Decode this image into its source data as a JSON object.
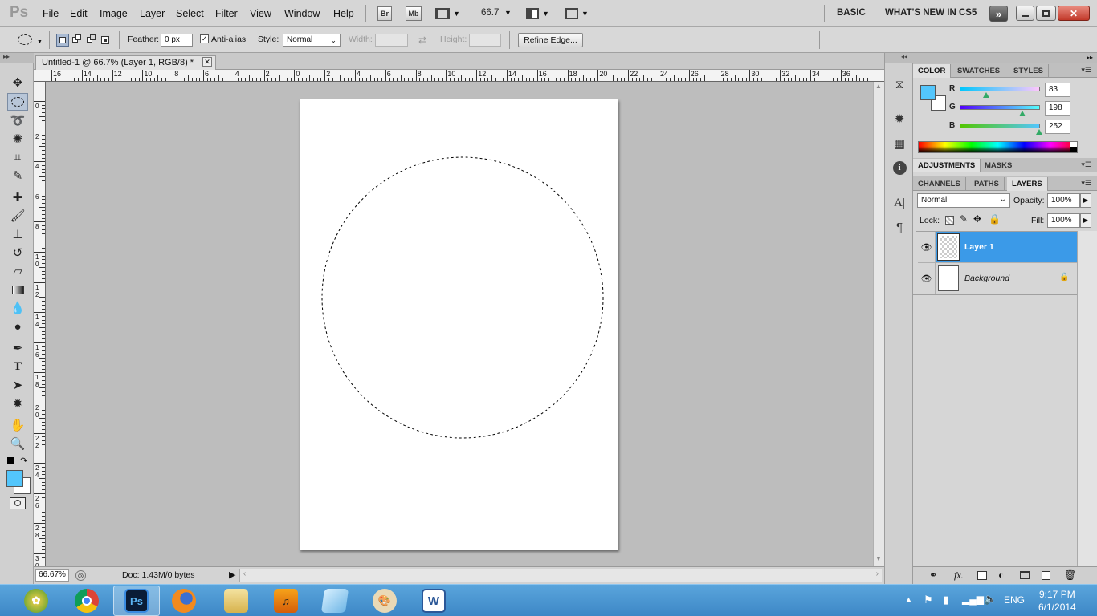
{
  "app": {
    "logo": "Ps"
  },
  "menu": [
    "File",
    "Edit",
    "Image",
    "Layer",
    "Select",
    "Filter",
    "View",
    "Window",
    "Help"
  ],
  "appbar": {
    "bridge": "Br",
    "minibridge": "Mb",
    "zoom": "66.7"
  },
  "workspace": {
    "basic": "BASIC",
    "whats_new": "WHAT'S NEW IN CS5"
  },
  "options": {
    "feather_label": "Feather:",
    "feather_value": "0 px",
    "antialias_label": "Anti-alias",
    "antialias_checked": true,
    "style_label": "Style:",
    "style_value": "Normal",
    "width_label": "Width:",
    "height_label": "Height:",
    "refine_edge": "Refine Edge..."
  },
  "document": {
    "tab_title": "Untitled-1 @ 66.7% (Layer 1, RGB/8) *"
  },
  "ruler_h": [
    "16",
    "14",
    "12",
    "10",
    "8",
    "6",
    "4",
    "2",
    "0",
    "2",
    "4",
    "6",
    "8",
    "10",
    "12",
    "14",
    "16",
    "18",
    "20",
    "22",
    "24",
    "26",
    "28",
    "30",
    "32",
    "34",
    "36"
  ],
  "ruler_v": [
    "0",
    "2",
    "4",
    "6",
    "8",
    "1\n0",
    "1\n2",
    "1\n4",
    "1\n6",
    "1\n8",
    "2\n0",
    "2\n2",
    "2\n4",
    "2\n6",
    "2\n8",
    "3\n0"
  ],
  "status": {
    "zoom": "66.67%",
    "doc": "Doc: 1.43M/0 bytes"
  },
  "color_panel": {
    "tabs": [
      "COLOR",
      "SWATCHES",
      "STYLES"
    ],
    "r_label": "R",
    "g_label": "G",
    "b_label": "B",
    "r": 83,
    "g": 198,
    "b": 252,
    "foreground": "#53c6fc",
    "background": "#ffffff"
  },
  "adjust_panel": {
    "tabs": [
      "ADJUSTMENTS",
      "MASKS"
    ]
  },
  "layers_panel": {
    "tabs": [
      "CHANNELS",
      "PATHS",
      "LAYERS"
    ],
    "blend_mode": "Normal",
    "opacity_label": "Opacity:",
    "opacity": "100%",
    "lock_label": "Lock:",
    "fill_label": "Fill:",
    "fill": "100%",
    "layers": [
      {
        "name": "Layer 1",
        "selected": true
      },
      {
        "name": "Background",
        "locked": true
      }
    ]
  },
  "taskbar": {
    "apps": [
      "Windows Live",
      "Chrome",
      "Photoshop",
      "Firefox",
      "File Explorer",
      "Music",
      "Notes",
      "Paint",
      "Word"
    ],
    "tray": {
      "lang": "ENG",
      "time": "9:17 PM",
      "date": "6/1/2014"
    }
  },
  "colors": {
    "accent": "#3b9ae8",
    "selection_blue": "#38a0f0"
  }
}
